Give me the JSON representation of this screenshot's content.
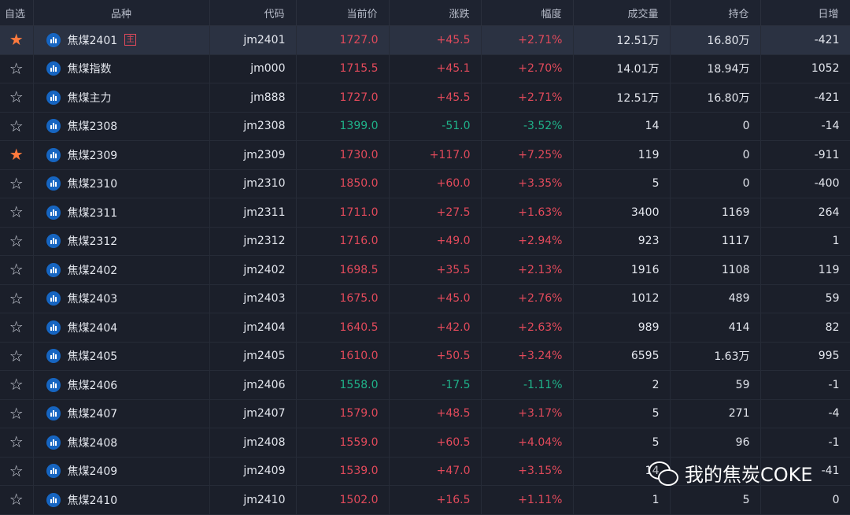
{
  "header": {
    "columns": [
      "自选",
      "品种",
      "代码",
      "当前价",
      "涨跌",
      "幅度",
      "成交量",
      "持仓",
      "日增"
    ]
  },
  "colors": {
    "up": "#e24a5b",
    "down": "#1fb38a",
    "star_on": "#ff7a3d",
    "icon_blue": "#1665c1"
  },
  "icons": {
    "star": "star-icon",
    "symbol": "bar-chart-icon"
  },
  "rows": [
    {
      "fav": true,
      "name": "焦煤2401",
      "badge": "主",
      "code": "jm2401",
      "price": "1727.0",
      "change": "+45.5",
      "pct": "+2.71%",
      "volume": "12.51万",
      "oi": "16.80万",
      "daily": "-421",
      "dir": "up"
    },
    {
      "fav": false,
      "name": "焦煤指数",
      "code": "jm000",
      "price": "1715.5",
      "change": "+45.1",
      "pct": "+2.70%",
      "volume": "14.01万",
      "oi": "18.94万",
      "daily": "1052",
      "dir": "up"
    },
    {
      "fav": false,
      "name": "焦煤主力",
      "code": "jm888",
      "price": "1727.0",
      "change": "+45.5",
      "pct": "+2.71%",
      "volume": "12.51万",
      "oi": "16.80万",
      "daily": "-421",
      "dir": "up"
    },
    {
      "fav": false,
      "name": "焦煤2308",
      "code": "jm2308",
      "price": "1399.0",
      "change": "-51.0",
      "pct": "-3.52%",
      "volume": "14",
      "oi": "0",
      "daily": "-14",
      "dir": "down"
    },
    {
      "fav": true,
      "name": "焦煤2309",
      "code": "jm2309",
      "price": "1730.0",
      "change": "+117.0",
      "pct": "+7.25%",
      "volume": "119",
      "oi": "0",
      "daily": "-911",
      "dir": "up"
    },
    {
      "fav": false,
      "name": "焦煤2310",
      "code": "jm2310",
      "price": "1850.0",
      "change": "+60.0",
      "pct": "+3.35%",
      "volume": "5",
      "oi": "0",
      "daily": "-400",
      "dir": "up"
    },
    {
      "fav": false,
      "name": "焦煤2311",
      "code": "jm2311",
      "price": "1711.0",
      "change": "+27.5",
      "pct": "+1.63%",
      "volume": "3400",
      "oi": "1169",
      "daily": "264",
      "dir": "up"
    },
    {
      "fav": false,
      "name": "焦煤2312",
      "code": "jm2312",
      "price": "1716.0",
      "change": "+49.0",
      "pct": "+2.94%",
      "volume": "923",
      "oi": "1117",
      "daily": "1",
      "dir": "up"
    },
    {
      "fav": false,
      "name": "焦煤2402",
      "code": "jm2402",
      "price": "1698.5",
      "change": "+35.5",
      "pct": "+2.13%",
      "volume": "1916",
      "oi": "1108",
      "daily": "119",
      "dir": "up"
    },
    {
      "fav": false,
      "name": "焦煤2403",
      "code": "jm2403",
      "price": "1675.0",
      "change": "+45.0",
      "pct": "+2.76%",
      "volume": "1012",
      "oi": "489",
      "daily": "59",
      "dir": "up"
    },
    {
      "fav": false,
      "name": "焦煤2404",
      "code": "jm2404",
      "price": "1640.5",
      "change": "+42.0",
      "pct": "+2.63%",
      "volume": "989",
      "oi": "414",
      "daily": "82",
      "dir": "up"
    },
    {
      "fav": false,
      "name": "焦煤2405",
      "code": "jm2405",
      "price": "1610.0",
      "change": "+50.5",
      "pct": "+3.24%",
      "volume": "6595",
      "oi": "1.63万",
      "daily": "995",
      "dir": "up"
    },
    {
      "fav": false,
      "name": "焦煤2406",
      "code": "jm2406",
      "price": "1558.0",
      "change": "-17.5",
      "pct": "-1.11%",
      "volume": "2",
      "oi": "59",
      "daily": "-1",
      "dir": "down"
    },
    {
      "fav": false,
      "name": "焦煤2407",
      "code": "jm2407",
      "price": "1579.0",
      "change": "+48.5",
      "pct": "+3.17%",
      "volume": "5",
      "oi": "271",
      "daily": "-4",
      "dir": "up"
    },
    {
      "fav": false,
      "name": "焦煤2408",
      "code": "jm2408",
      "price": "1559.0",
      "change": "+60.5",
      "pct": "+4.04%",
      "volume": "5",
      "oi": "96",
      "daily": "-1",
      "dir": "up"
    },
    {
      "fav": false,
      "name": "焦煤2409",
      "code": "jm2409",
      "price": "1539.0",
      "change": "+47.0",
      "pct": "+3.15%",
      "volume": "14",
      "oi": "",
      "daily": "-41",
      "dir": "up"
    },
    {
      "fav": false,
      "name": "焦煤2410",
      "code": "jm2410",
      "price": "1502.0",
      "change": "+16.5",
      "pct": "+1.11%",
      "volume": "1",
      "oi": "5",
      "daily": "0",
      "dir": "up"
    }
  ],
  "watermark": {
    "text": "我的焦炭COKE",
    "icon": "wechat-icon"
  }
}
